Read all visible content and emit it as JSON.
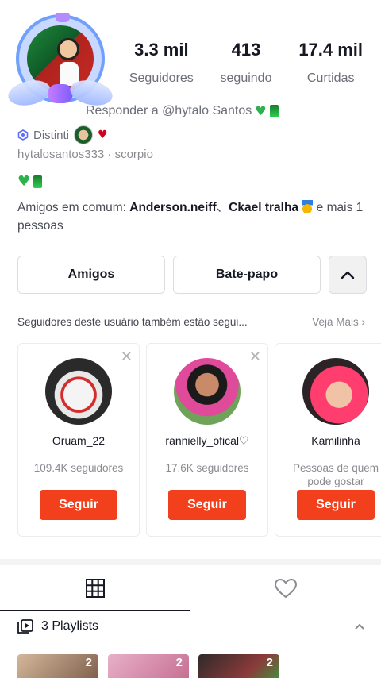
{
  "profile": {
    "username": "hytalosantos333",
    "zodiac": "scorpio",
    "distinction_label": "Distinti"
  },
  "stats": [
    {
      "value": "3.3 mil",
      "label": "Seguidores"
    },
    {
      "value": "413",
      "label": "seguindo"
    },
    {
      "value": "17.4 mil",
      "label": "Curtidas"
    }
  ],
  "reply": {
    "text": "Responder a @hytalo Santos"
  },
  "mutual": {
    "prefix": "Amigos em comum: ",
    "friend1": "Anderson.neiff",
    "separator": "、",
    "friend2": "Ckael tralha",
    "suffix": " e mais 1 pessoas"
  },
  "actions": {
    "friends_label": "Amigos",
    "chat_label": "Bate-papo"
  },
  "suggestions": {
    "title": "Seguidores deste usuário também estão segui...",
    "see_more": "Veja Mais",
    "follow_label": "Seguir",
    "cards": [
      {
        "name": "Oruam_22",
        "sub": "109.4K seguidores"
      },
      {
        "name": "rannielly_ofical♡",
        "sub": "17.6K seguidores"
      },
      {
        "name": "Kamilinha",
        "sub": "Pessoas de quem pode gostar"
      }
    ]
  },
  "playlists": {
    "label": "3 Playlists",
    "items": [
      {
        "count": "2"
      },
      {
        "count": "2"
      },
      {
        "count": "2"
      }
    ]
  },
  "colors": {
    "follow_button": "#f2401c",
    "text_primary": "#161823",
    "text_secondary": "#6b6e78"
  }
}
